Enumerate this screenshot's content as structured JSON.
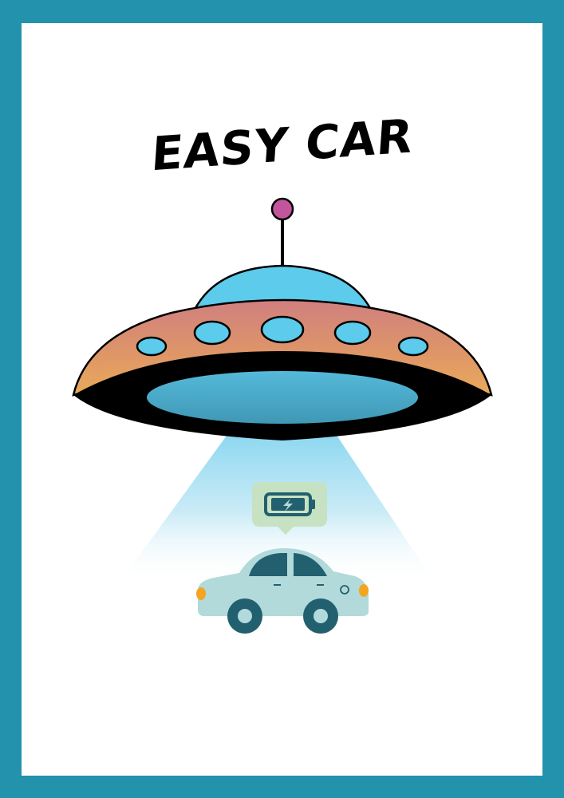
{
  "poster": {
    "title": "EASY CAR"
  },
  "colors": {
    "border": "#2392ad",
    "dome": "#5ccbec",
    "antenna_ball": "#c3559c",
    "hull_top": "#d4837a",
    "hull_bottom": "#e8a85c",
    "beam": "#8fd6ee",
    "car_body": "#b2dadb",
    "car_dark": "#22606f",
    "car_light": "#f3a522",
    "bubble": "#c7e2c2"
  },
  "icons": [
    "ufo-icon",
    "battery-charging-icon",
    "car-icon"
  ]
}
